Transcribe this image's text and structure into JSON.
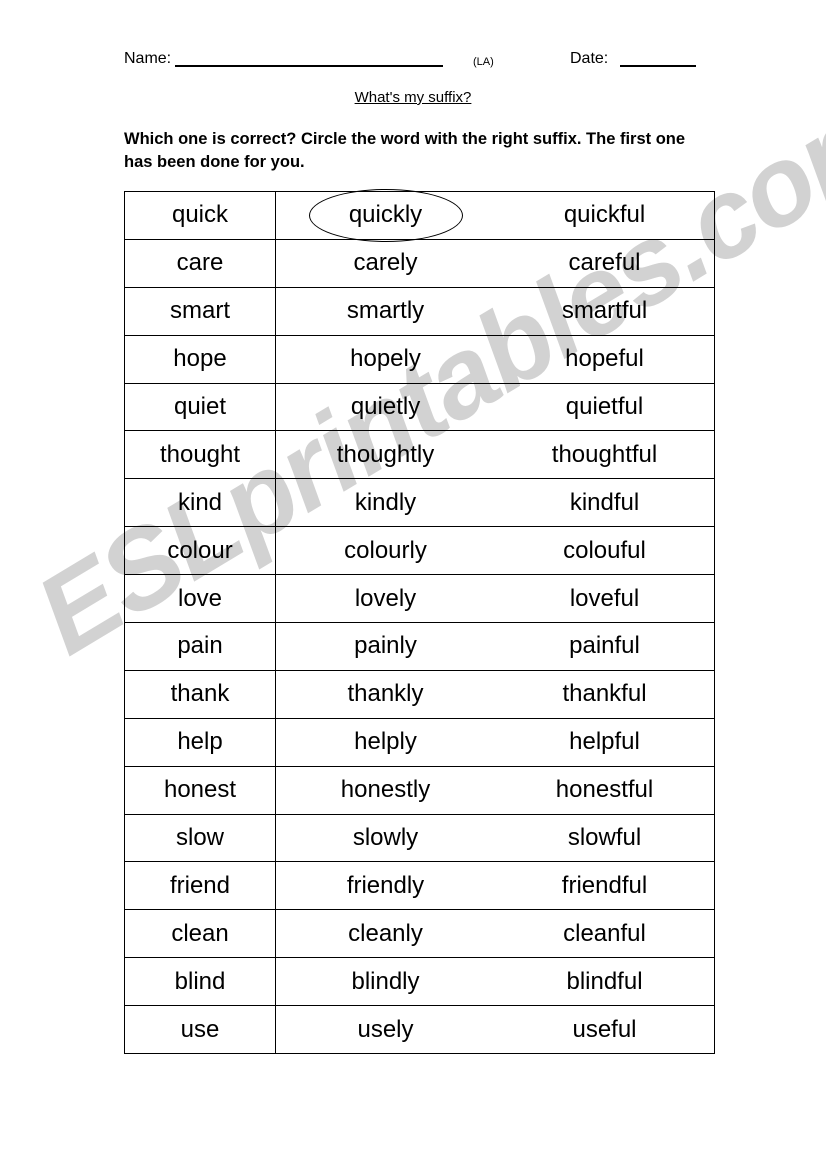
{
  "header": {
    "name_label": "Name:",
    "name_value": "",
    "la_tag": "(LA)",
    "date_label": "Date:",
    "date_value": ""
  },
  "title": "What's my suffix?",
  "instructions": "Which one is correct? Circle the word with the right suffix. The first one has been done for you.",
  "watermark": "ESLprintables.com",
  "watermark_color": "#d2d2d2",
  "table": {
    "circled_row_index": 0,
    "circled_column_index": 1,
    "rows": [
      {
        "base": "quick",
        "option_ly": "quickly",
        "option_ful": "quickful"
      },
      {
        "base": "care",
        "option_ly": "carely",
        "option_ful": "careful"
      },
      {
        "base": "smart",
        "option_ly": "smartly",
        "option_ful": "smartful"
      },
      {
        "base": "hope",
        "option_ly": "hopely",
        "option_ful": "hopeful"
      },
      {
        "base": "quiet",
        "option_ly": "quietly",
        "option_ful": "quietful"
      },
      {
        "base": "thought",
        "option_ly": "thoughtly",
        "option_ful": "thoughtful"
      },
      {
        "base": "kind",
        "option_ly": "kindly",
        "option_ful": "kindful"
      },
      {
        "base": "colour",
        "option_ly": "colourly",
        "option_ful": "colouful"
      },
      {
        "base": "love",
        "option_ly": "lovely",
        "option_ful": "loveful"
      },
      {
        "base": "pain",
        "option_ly": "painly",
        "option_ful": "painful"
      },
      {
        "base": "thank",
        "option_ly": "thankly",
        "option_ful": "thankful"
      },
      {
        "base": "help",
        "option_ly": "helply",
        "option_ful": "helpful"
      },
      {
        "base": "honest",
        "option_ly": "honestly",
        "option_ful": "honestful"
      },
      {
        "base": "slow",
        "option_ly": "slowly",
        "option_ful": "slowful"
      },
      {
        "base": "friend",
        "option_ly": "friendly",
        "option_ful": "friendful"
      },
      {
        "base": "clean",
        "option_ly": "cleanly",
        "option_ful": "cleanful"
      },
      {
        "base": "blind",
        "option_ly": "blindly",
        "option_ful": "blindful"
      },
      {
        "base": "use",
        "option_ly": "usely",
        "option_ful": "useful"
      }
    ]
  }
}
